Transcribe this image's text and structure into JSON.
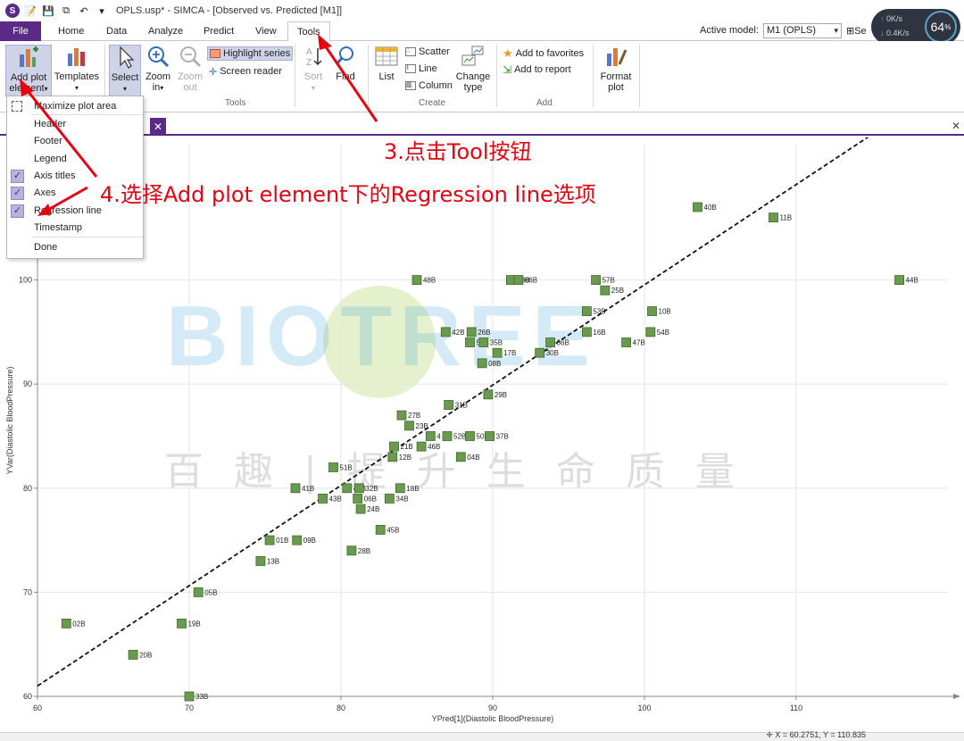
{
  "window": {
    "title": "OPLS.usp* - SIMCA - [Observed vs. Predicted [M1]]",
    "logo_letter": "S"
  },
  "menu": {
    "tabs": [
      "File",
      "Home",
      "Data",
      "Analyze",
      "Predict",
      "View",
      "Tools"
    ],
    "active_tab": "Tools",
    "active_model_label": "Active model:",
    "active_model_value": "M1 (OPLS)",
    "right_truncated": "Se"
  },
  "net_widget": {
    "up": "0K/s",
    "down": "0.4K/s",
    "percent": "64",
    "percent_unit": "%"
  },
  "ribbon": {
    "add_plot_element": {
      "line1": "Add plot",
      "line2": "element"
    },
    "templates": "Templates",
    "select": "Select",
    "zoom_in": {
      "line1": "Zoom",
      "line2": "in"
    },
    "zoom_out": {
      "line1": "Zoom",
      "line2": "out"
    },
    "highlight_series": "Highlight series",
    "screen_reader": "Screen reader",
    "sort": "Sort",
    "find": "Find",
    "tools_group": "Tools",
    "list": "List",
    "scatter": "Scatter",
    "line": "Line",
    "column": "Column",
    "change_type": {
      "line1": "Change",
      "line2": "type"
    },
    "create_group": "Create",
    "add_to_favorites": "Add to favorites",
    "add_to_report": "Add to report",
    "add_group": "Add",
    "format_plot": {
      "line1": "Format",
      "line2": "plot"
    }
  },
  "dropdown": {
    "items": [
      {
        "label": "Maximize plot area",
        "checked": false,
        "icon": "maximize-icon"
      },
      {
        "label": "Header",
        "checked": false
      },
      {
        "label": "Footer",
        "checked": false
      },
      {
        "label": "Legend",
        "checked": false
      },
      {
        "label": "Axis titles",
        "checked": true
      },
      {
        "label": "Axes",
        "checked": true
      },
      {
        "label": "Regression line",
        "checked": true
      },
      {
        "label": "Timestamp",
        "checked": false
      },
      {
        "label": "Done",
        "checked": false
      }
    ]
  },
  "annotations": {
    "step3": "3.点击Tool按钮",
    "step4": "4.选择Add plot element下的Regression line选项"
  },
  "watermark": {
    "text": "BIOTREE",
    "cn": "百趣|提升生命质量"
  },
  "status": {
    "coords": "X = 60.2751, Y = 110.835"
  },
  "colors": {
    "accent": "#5b2a86",
    "point_fill": "#6a9a4e",
    "point_stroke": "#3f6a2c",
    "annotation": "#e60012"
  },
  "chart_data": {
    "type": "scatter",
    "xlabel": "YPred[1](Diastolic BloodPressure)",
    "ylabel": "YVar(Diastolic BloodPressure)",
    "xlim": [
      60,
      120
    ],
    "ylim": [
      60,
      113
    ],
    "xticks": [
      60,
      70,
      80,
      90,
      100,
      110
    ],
    "yticks": [
      60,
      70,
      80,
      90,
      100
    ],
    "grid": true,
    "regression_line": {
      "x": [
        60,
        120
      ],
      "y": [
        61,
        118.8
      ],
      "style": "dashed"
    },
    "points": [
      {
        "x": 103.5,
        "y": 107,
        "label": "40B"
      },
      {
        "x": 108.5,
        "y": 106,
        "label": "11B"
      },
      {
        "x": 116.8,
        "y": 100,
        "label": "44B"
      },
      {
        "x": 85,
        "y": 100,
        "label": "48B"
      },
      {
        "x": 91.2,
        "y": 100,
        "label": "03B"
      },
      {
        "x": 91.7,
        "y": 100,
        "label": "06B"
      },
      {
        "x": 96.8,
        "y": 100,
        "label": "57B"
      },
      {
        "x": 97.4,
        "y": 99,
        "label": "25B"
      },
      {
        "x": 96.2,
        "y": 97,
        "label": "53B"
      },
      {
        "x": 100.5,
        "y": 97,
        "label": "10B"
      },
      {
        "x": 86.9,
        "y": 95,
        "label": "42B"
      },
      {
        "x": 88.6,
        "y": 95,
        "label": "26B"
      },
      {
        "x": 96.2,
        "y": 95,
        "label": "16B"
      },
      {
        "x": 100.4,
        "y": 95,
        "label": "54B"
      },
      {
        "x": 88.5,
        "y": 94,
        "label": "56B"
      },
      {
        "x": 89.4,
        "y": 94,
        "label": "35B"
      },
      {
        "x": 93.8,
        "y": 94,
        "label": "36B"
      },
      {
        "x": 98.8,
        "y": 94,
        "label": "47B"
      },
      {
        "x": 90.3,
        "y": 93,
        "label": "17B"
      },
      {
        "x": 93.1,
        "y": 93,
        "label": "30B"
      },
      {
        "x": 89.3,
        "y": 92,
        "label": "08B"
      },
      {
        "x": 89.7,
        "y": 89,
        "label": "29B"
      },
      {
        "x": 87.1,
        "y": 88,
        "label": "31B"
      },
      {
        "x": 84,
        "y": 87,
        "label": "27B"
      },
      {
        "x": 84.5,
        "y": 86,
        "label": "23B"
      },
      {
        "x": 85.9,
        "y": 85,
        "label": "4"
      },
      {
        "x": 87,
        "y": 85,
        "label": "52B"
      },
      {
        "x": 88.5,
        "y": 85,
        "label": "50B"
      },
      {
        "x": 89.8,
        "y": 85,
        "label": "37B"
      },
      {
        "x": 83.5,
        "y": 84,
        "label": "21B"
      },
      {
        "x": 85.3,
        "y": 84,
        "label": "46B"
      },
      {
        "x": 83.4,
        "y": 83,
        "label": "12B"
      },
      {
        "x": 87.9,
        "y": 83,
        "label": "04B"
      },
      {
        "x": 79.5,
        "y": 82,
        "label": "51B"
      },
      {
        "x": 77,
        "y": 80,
        "label": "41B"
      },
      {
        "x": 80.4,
        "y": 80,
        "label": "42B"
      },
      {
        "x": 81.2,
        "y": 80,
        "label": "32B"
      },
      {
        "x": 83.9,
        "y": 80,
        "label": "18B"
      },
      {
        "x": 78.8,
        "y": 79,
        "label": "43B"
      },
      {
        "x": 81.1,
        "y": 79,
        "label": "06B"
      },
      {
        "x": 83.2,
        "y": 79,
        "label": "34B"
      },
      {
        "x": 81.3,
        "y": 78,
        "label": "24B"
      },
      {
        "x": 82.6,
        "y": 76,
        "label": "45B"
      },
      {
        "x": 75.3,
        "y": 75,
        "label": "01B"
      },
      {
        "x": 77.1,
        "y": 75,
        "label": "09B"
      },
      {
        "x": 80.7,
        "y": 74,
        "label": "28B"
      },
      {
        "x": 74.7,
        "y": 73,
        "label": "13B"
      },
      {
        "x": 70.6,
        "y": 70,
        "label": "05B"
      },
      {
        "x": 61.9,
        "y": 67,
        "label": "02B"
      },
      {
        "x": 69.5,
        "y": 67,
        "label": "19B"
      },
      {
        "x": 66.3,
        "y": 64,
        "label": "20B"
      },
      {
        "x": 70,
        "y": 60,
        "label": "33B"
      }
    ]
  }
}
